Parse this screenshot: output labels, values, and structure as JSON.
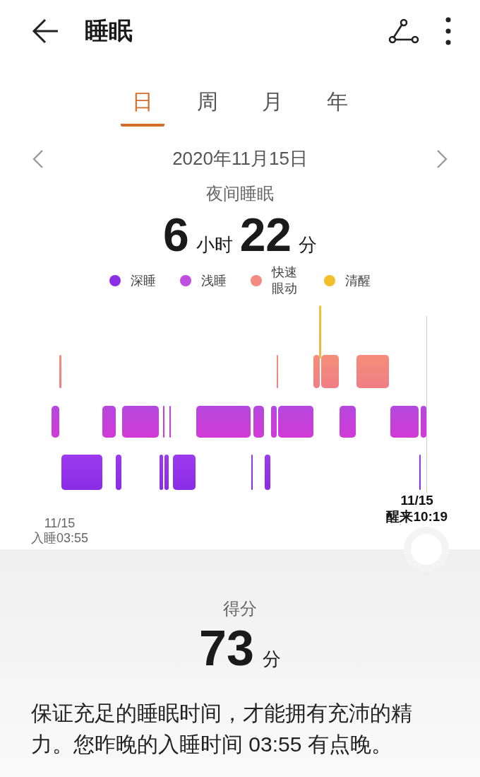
{
  "header": {
    "title": "睡眠"
  },
  "tabs": [
    {
      "label": "日",
      "selected": true
    },
    {
      "label": "周",
      "selected": false
    },
    {
      "label": "月",
      "selected": false
    },
    {
      "label": "年",
      "selected": false
    }
  ],
  "date": "2020年11月15日",
  "summary": {
    "label": "夜间睡眠",
    "hours": "6",
    "hours_unit": "小时",
    "minutes": "22",
    "minutes_unit": "分"
  },
  "legend": [
    {
      "label": "深睡",
      "color": "#8b2ee6"
    },
    {
      "label": "浅睡",
      "color": "#c04ee0"
    },
    {
      "label": "快速眼动",
      "color": "#f48a80"
    },
    {
      "label": "清醒",
      "color": "#f2bf2a"
    }
  ],
  "chart": {
    "start_date": "11/15",
    "start_label": "入睡03:55",
    "end_date": "11/15",
    "end_label": "醒来10:19"
  },
  "score": {
    "label": "得分",
    "value": "73",
    "unit": "分"
  },
  "advice": "保证充足的睡眠时间，才能拥有充沛的精力。您昨晚的入睡时间 03:55 有点晚。"
}
